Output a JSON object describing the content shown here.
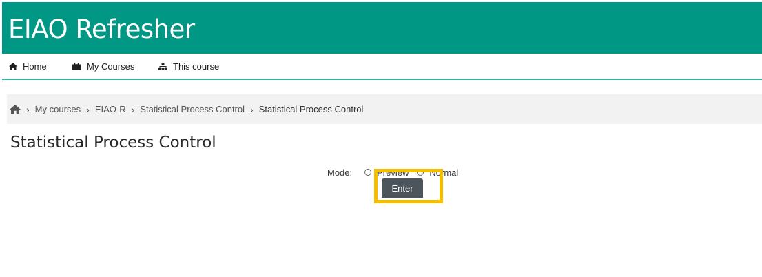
{
  "header": {
    "site_title": "EIAO Refresher"
  },
  "nav": {
    "items": [
      {
        "label": "Home",
        "icon": "home-icon"
      },
      {
        "label": "My Courses",
        "icon": "briefcase-icon"
      },
      {
        "label": "This course",
        "icon": "sitemap-icon"
      }
    ]
  },
  "breadcrumb": {
    "home_icon": "home-icon",
    "items": [
      "My courses",
      "EIAO-R",
      "Statistical Process Control"
    ],
    "current": "Statistical Process Control",
    "separator": "›"
  },
  "page": {
    "title": "Statistical Process Control"
  },
  "mode": {
    "label": "Mode:",
    "options": [
      "Preview",
      "Normal"
    ]
  },
  "enter_button": {
    "label": "Enter"
  },
  "colors": {
    "banner": "#009785",
    "nav_border": "#32b3a4",
    "breadcrumb_bg": "#f2f2f2",
    "button": "#4b555b",
    "highlight": "#f6be00"
  }
}
